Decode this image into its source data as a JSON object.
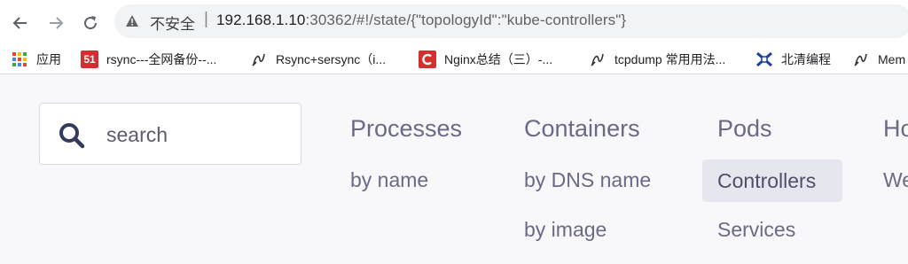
{
  "browser": {
    "address_bar": {
      "security_label": "不安全",
      "separator": "|",
      "url_host": "192.168.1.10",
      "url_rest": ":30362/#!/state/{\"topologyId\":\"kube-controllers\"}"
    },
    "bookmarks": [
      {
        "label": "应用",
        "icon": "apps-grid-icon"
      },
      {
        "label": "rsync---全网备份--...",
        "icon": "51cto-icon",
        "color": "#d32f2f"
      },
      {
        "label": "Rsync+sersync（i...",
        "icon": "pen-icon"
      },
      {
        "label": "Nginx总结（三）-...",
        "icon": "c-icon",
        "color": "#d32f2f"
      },
      {
        "label": "tcpdump 常用用法...",
        "icon": "pen-icon"
      },
      {
        "label": "北清编程",
        "icon": "bq-icon",
        "color": "#1a3fa0"
      },
      {
        "label": "Mem",
        "icon": "pen-icon"
      }
    ]
  },
  "search": {
    "placeholder": "search"
  },
  "menu": {
    "processes": {
      "title": "Processes",
      "items": [
        "by name"
      ]
    },
    "containers": {
      "title": "Containers",
      "items": [
        "by DNS name",
        "by image"
      ]
    },
    "pods": {
      "title": "Pods",
      "items": [
        "Controllers",
        "Services"
      ],
      "active": "Controllers"
    },
    "hosts": {
      "title": "Ho",
      "items": [
        "We"
      ]
    }
  },
  "colors": {
    "menu_text": "#6a6a86",
    "active_bg": "#e6e6ee",
    "page_bg": "#f8f8fb"
  }
}
